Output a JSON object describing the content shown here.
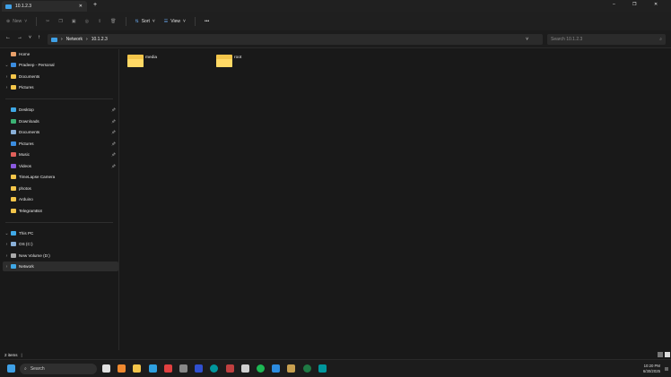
{
  "tab": {
    "title": "10.1.2.3",
    "close": "✕",
    "new": "+"
  },
  "window": {
    "minimize": "–",
    "maximize": "❐",
    "close": "✕"
  },
  "toolbar": {
    "new": "New",
    "sort": "Sort",
    "view": "View",
    "more": "•••"
  },
  "address": {
    "segments": [
      "Network",
      "10.1.2.3"
    ],
    "search_placeholder": "Search 10.1.2.3"
  },
  "sidebar": {
    "items": [
      {
        "label": "Home",
        "icon": "home-icon",
        "color": "#e8a06a",
        "chev": ""
      },
      {
        "label": "Pradeep - Personal",
        "icon": "cloud-icon",
        "color": "#3b8de0",
        "chev": "⌄"
      },
      {
        "label": "Documents",
        "icon": "folder-icon",
        "color": "#f3c54a",
        "chev": "›",
        "indent": 1
      },
      {
        "label": "Pictures",
        "icon": "folder-icon",
        "color": "#f3c54a",
        "chev": "›",
        "indent": 1
      },
      {
        "label": "Desktop",
        "icon": "desktop-icon",
        "color": "#3fa8e6",
        "pin": true
      },
      {
        "label": "Downloads",
        "icon": "download-icon",
        "color": "#3bb273",
        "pin": true
      },
      {
        "label": "Documents",
        "icon": "document-icon",
        "color": "#8ab0d8",
        "pin": true
      },
      {
        "label": "Pictures",
        "icon": "pictures-icon",
        "color": "#3b8de0",
        "pin": true
      },
      {
        "label": "Music",
        "icon": "music-icon",
        "color": "#e0605a",
        "pin": true
      },
      {
        "label": "Videos",
        "icon": "videos-icon",
        "color": "#8a5ae0",
        "pin": true
      },
      {
        "label": "TimeLapse Camera",
        "icon": "folder-icon",
        "color": "#f3c54a"
      },
      {
        "label": "photos",
        "icon": "folder-icon",
        "color": "#f3c54a"
      },
      {
        "label": "Arduino",
        "icon": "folder-icon",
        "color": "#f3c54a"
      },
      {
        "label": "TelegramBot",
        "icon": "folder-icon",
        "color": "#f3c54a"
      },
      {
        "label": "This PC",
        "icon": "pc-icon",
        "color": "#3fa8e6",
        "chev": "⌄"
      },
      {
        "label": "OS (C:)",
        "icon": "drive-icon",
        "color": "#8ab0d8",
        "chev": "›",
        "indent": 1
      },
      {
        "label": "New Volume (D:)",
        "icon": "drive-icon",
        "color": "#aaaaaa",
        "chev": "›",
        "indent": 1
      },
      {
        "label": "Network",
        "icon": "network-icon",
        "color": "#3fa8e6",
        "chev": "›",
        "selected": true
      }
    ]
  },
  "content": {
    "folders": [
      "media",
      "root"
    ]
  },
  "status": {
    "count": "2 items"
  },
  "taskbar": {
    "search": "Search",
    "time": "10:20 PM",
    "date": "6/30/2025",
    "apps": [
      "#e0e0e0",
      "#f08a30",
      "#f3c54a",
      "#2ea0e0",
      "#e04040",
      "#888888",
      "#3050d0",
      "#00979d",
      "#c04040",
      "#d0d0d0",
      "#1db954",
      "#2c8ce0",
      "#c8a050",
      "#1f7a44",
      "#00979d"
    ]
  }
}
